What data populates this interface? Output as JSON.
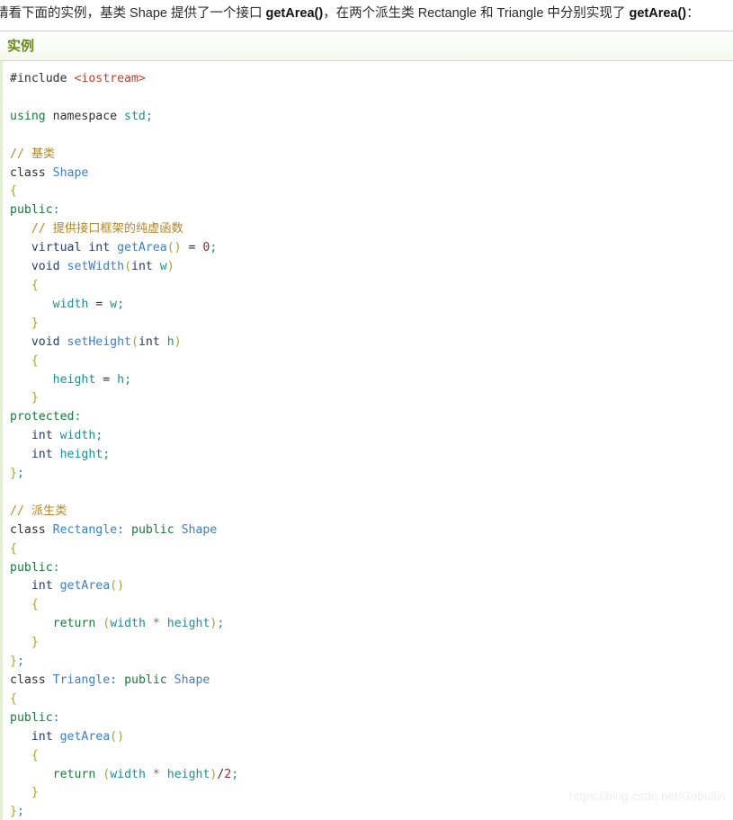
{
  "intro": {
    "segments": [
      {
        "text": "请看下面的实例，基类 Shape 提供了一个接口 ",
        "bold": false
      },
      {
        "text": "getArea()",
        "bold": true
      },
      {
        "text": "，在两个派生类 Rectangle 和 Triangle 中分别实现了 ",
        "bold": false
      },
      {
        "text": "getArea()",
        "bold": true
      },
      {
        "text": "：",
        "bold": false
      }
    ],
    "full_text": "请看下面的实例，基类 Shape 提供了一个接口 getArea()，在两个派生类 Rectangle 和 Triangle 中分别实现了 getArea()："
  },
  "example_header": {
    "title": "实例",
    "title_color": "#6b8a16",
    "background_color": "#f5f7ef"
  },
  "code_block": {
    "language": "cpp",
    "border_color": "#e4eed4",
    "background_color": "#ffffff",
    "lines": [
      [
        {
          "t": "#include ",
          "c": "pre"
        },
        {
          "t": "<iostream>",
          "c": "str"
        }
      ],
      [],
      [
        {
          "t": "using",
          "c": "kw"
        },
        {
          "t": " namespace ",
          "c": "pre"
        },
        {
          "t": "std",
          "c": "var"
        },
        {
          "t": ";",
          "c": "semi"
        }
      ],
      [],
      [
        {
          "t": "// 基类",
          "c": "com"
        }
      ],
      [
        {
          "t": "class ",
          "c": "pre"
        },
        {
          "t": "Shape",
          "c": "fn"
        }
      ],
      [
        {
          "t": "{",
          "c": "brace"
        }
      ],
      [
        {
          "t": "public",
          "c": "kw"
        },
        {
          "t": ":",
          "c": "semi"
        }
      ],
      [
        {
          "t": "   ",
          "c": "pre"
        },
        {
          "t": "// 提供接口框架的纯虚函数",
          "c": "com"
        }
      ],
      [
        {
          "t": "   ",
          "c": "pre"
        },
        {
          "t": "virtual int ",
          "c": "type"
        },
        {
          "t": "getArea",
          "c": "fn"
        },
        {
          "t": "()",
          "c": "brace"
        },
        {
          "t": " = ",
          "c": "pre"
        },
        {
          "t": "0",
          "c": "num"
        },
        {
          "t": ";",
          "c": "semi"
        }
      ],
      [
        {
          "t": "   ",
          "c": "pre"
        },
        {
          "t": "void ",
          "c": "type"
        },
        {
          "t": "setWidth",
          "c": "fn"
        },
        {
          "t": "(",
          "c": "brace"
        },
        {
          "t": "int ",
          "c": "type"
        },
        {
          "t": "w",
          "c": "var"
        },
        {
          "t": ")",
          "c": "brace"
        }
      ],
      [
        {
          "t": "   ",
          "c": "pre"
        },
        {
          "t": "{",
          "c": "brace"
        }
      ],
      [
        {
          "t": "      ",
          "c": "pre"
        },
        {
          "t": "width",
          "c": "var"
        },
        {
          "t": " = ",
          "c": "pre"
        },
        {
          "t": "w",
          "c": "var"
        },
        {
          "t": ";",
          "c": "semi"
        }
      ],
      [
        {
          "t": "   ",
          "c": "pre"
        },
        {
          "t": "}",
          "c": "brace"
        }
      ],
      [
        {
          "t": "   ",
          "c": "pre"
        },
        {
          "t": "void ",
          "c": "type"
        },
        {
          "t": "setHeight",
          "c": "fn"
        },
        {
          "t": "(",
          "c": "brace"
        },
        {
          "t": "int ",
          "c": "type"
        },
        {
          "t": "h",
          "c": "var"
        },
        {
          "t": ")",
          "c": "brace"
        }
      ],
      [
        {
          "t": "   ",
          "c": "pre"
        },
        {
          "t": "{",
          "c": "brace"
        }
      ],
      [
        {
          "t": "      ",
          "c": "pre"
        },
        {
          "t": "height",
          "c": "var"
        },
        {
          "t": " = ",
          "c": "pre"
        },
        {
          "t": "h",
          "c": "var"
        },
        {
          "t": ";",
          "c": "semi"
        }
      ],
      [
        {
          "t": "   ",
          "c": "pre"
        },
        {
          "t": "}",
          "c": "brace"
        }
      ],
      [
        {
          "t": "protected",
          "c": "kw"
        },
        {
          "t": ":",
          "c": "semi"
        }
      ],
      [
        {
          "t": "   ",
          "c": "pre"
        },
        {
          "t": "int ",
          "c": "type"
        },
        {
          "t": "width",
          "c": "var"
        },
        {
          "t": ";",
          "c": "semi"
        }
      ],
      [
        {
          "t": "   ",
          "c": "pre"
        },
        {
          "t": "int ",
          "c": "type"
        },
        {
          "t": "height",
          "c": "var"
        },
        {
          "t": ";",
          "c": "semi"
        }
      ],
      [
        {
          "t": "}",
          "c": "brace"
        },
        {
          "t": ";",
          "c": "semi"
        }
      ],
      [],
      [
        {
          "t": "// 派生类",
          "c": "com"
        }
      ],
      [
        {
          "t": "class ",
          "c": "pre"
        },
        {
          "t": "Rectangle",
          "c": "fn"
        },
        {
          "t": ":",
          "c": "semi"
        },
        {
          "t": " ",
          "c": "pre"
        },
        {
          "t": "public",
          "c": "kw"
        },
        {
          "t": " ",
          "c": "pre"
        },
        {
          "t": "Shape",
          "c": "fn"
        }
      ],
      [
        {
          "t": "{",
          "c": "brace"
        }
      ],
      [
        {
          "t": "public",
          "c": "kw"
        },
        {
          "t": ":",
          "c": "semi"
        }
      ],
      [
        {
          "t": "   ",
          "c": "pre"
        },
        {
          "t": "int ",
          "c": "type"
        },
        {
          "t": "getArea",
          "c": "fn"
        },
        {
          "t": "()",
          "c": "brace"
        }
      ],
      [
        {
          "t": "   ",
          "c": "pre"
        },
        {
          "t": "{",
          "c": "brace"
        }
      ],
      [
        {
          "t": "      ",
          "c": "pre"
        },
        {
          "t": "return",
          "c": "kw"
        },
        {
          "t": " ",
          "c": "pre"
        },
        {
          "t": "(",
          "c": "brace"
        },
        {
          "t": "width",
          "c": "var"
        },
        {
          "t": " ",
          "c": "pre"
        },
        {
          "t": "*",
          "c": "op"
        },
        {
          "t": " ",
          "c": "pre"
        },
        {
          "t": "height",
          "c": "var"
        },
        {
          "t": ")",
          "c": "brace"
        },
        {
          "t": ";",
          "c": "semi"
        }
      ],
      [
        {
          "t": "   ",
          "c": "pre"
        },
        {
          "t": "}",
          "c": "brace"
        }
      ],
      [
        {
          "t": "}",
          "c": "brace"
        },
        {
          "t": ";",
          "c": "semi"
        }
      ],
      [
        {
          "t": "class ",
          "c": "pre"
        },
        {
          "t": "Triangle",
          "c": "fn"
        },
        {
          "t": ":",
          "c": "semi"
        },
        {
          "t": " ",
          "c": "pre"
        },
        {
          "t": "public",
          "c": "kw"
        },
        {
          "t": " ",
          "c": "pre"
        },
        {
          "t": "Shape",
          "c": "fn"
        }
      ],
      [
        {
          "t": "{",
          "c": "brace"
        }
      ],
      [
        {
          "t": "public",
          "c": "kw"
        },
        {
          "t": ":",
          "c": "semi"
        }
      ],
      [
        {
          "t": "   ",
          "c": "pre"
        },
        {
          "t": "int ",
          "c": "type"
        },
        {
          "t": "getArea",
          "c": "fn"
        },
        {
          "t": "()",
          "c": "brace"
        }
      ],
      [
        {
          "t": "   ",
          "c": "pre"
        },
        {
          "t": "{",
          "c": "brace"
        }
      ],
      [
        {
          "t": "      ",
          "c": "pre"
        },
        {
          "t": "return",
          "c": "kw"
        },
        {
          "t": " ",
          "c": "pre"
        },
        {
          "t": "(",
          "c": "brace"
        },
        {
          "t": "width",
          "c": "var"
        },
        {
          "t": " ",
          "c": "pre"
        },
        {
          "t": "*",
          "c": "op"
        },
        {
          "t": " ",
          "c": "pre"
        },
        {
          "t": "height",
          "c": "var"
        },
        {
          "t": ")",
          "c": "brace"
        },
        {
          "t": "/",
          "c": "pre"
        },
        {
          "t": "2",
          "c": "num"
        },
        {
          "t": ";",
          "c": "semi"
        }
      ],
      [
        {
          "t": "   ",
          "c": "pre"
        },
        {
          "t": "}",
          "c": "brace"
        }
      ],
      [
        {
          "t": "}",
          "c": "brace"
        },
        {
          "t": ";",
          "c": "semi"
        }
      ]
    ]
  },
  "watermark": {
    "text": "https://blog.csdn.net/Gobullin"
  }
}
